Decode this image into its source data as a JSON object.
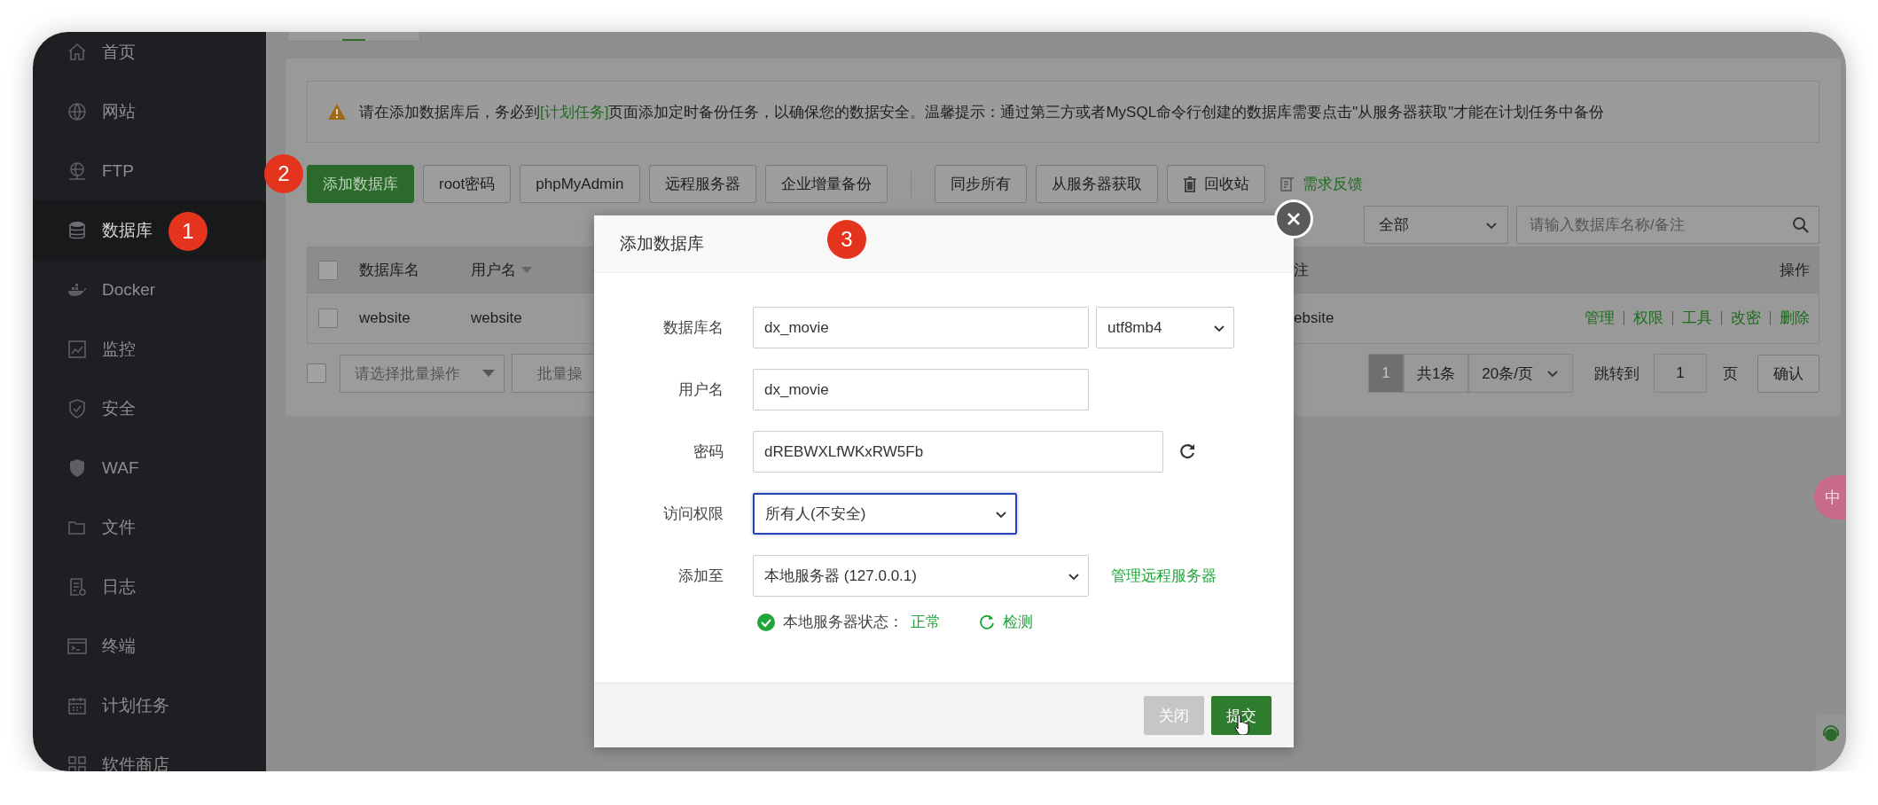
{
  "sidebar": {
    "items": [
      {
        "label": "首页",
        "selected": false
      },
      {
        "label": "网站",
        "selected": false
      },
      {
        "label": "FTP",
        "selected": false
      },
      {
        "label": "数据库",
        "selected": true
      },
      {
        "label": "Docker",
        "selected": false
      },
      {
        "label": "监控",
        "selected": false
      },
      {
        "label": "安全",
        "selected": false
      },
      {
        "label": "WAF",
        "selected": false
      },
      {
        "label": "文件",
        "selected": false
      },
      {
        "label": "日志",
        "selected": false
      },
      {
        "label": "终端",
        "selected": false
      },
      {
        "label": "计划任务",
        "selected": false
      },
      {
        "label": "软件商店",
        "selected": false
      }
    ]
  },
  "notice": {
    "text_before": "请在添加数据库后，务必到",
    "link": "[计划任务]",
    "text_after": "页面添加定时备份任务，以确保您的数据安全。温馨提示：通过第三方或者MySQL命令行创建的数据库需要点击\"从服务器获取\"才能在计划任务中备份"
  },
  "toolbar": {
    "buttons": [
      {
        "label": "添加数据库",
        "kind": "primary"
      },
      {
        "label": "root密码",
        "kind": "plain"
      },
      {
        "label": "phpMyAdmin",
        "kind": "plain"
      },
      {
        "label": "远程服务器",
        "kind": "plain"
      },
      {
        "label": "企业增量备份",
        "kind": "plain"
      },
      {
        "label": "同步所有",
        "kind": "plain"
      },
      {
        "label": "从服务器获取",
        "kind": "plain"
      },
      {
        "label": "回收站",
        "kind": "trash"
      },
      {
        "label": "需求反馈",
        "kind": "link"
      }
    ]
  },
  "filter": {
    "select": "全部",
    "search_placeholder": "请输入数据库名称/备注"
  },
  "table": {
    "select_all_checked": false,
    "columns": [
      "数据库名",
      "用户名",
      "注",
      "操作"
    ],
    "rows": [
      {
        "checked": false,
        "cells": [
          "website",
          "website",
          "ebsite"
        ],
        "actions": [
          "管理",
          "权限",
          "工具",
          "改密",
          "删除"
        ]
      }
    ]
  },
  "footer": {
    "checked": false,
    "batch_select": "请选择批量操作",
    "batch_button": "批量操",
    "page": "1",
    "total": "共1条",
    "per_page": "20条/页",
    "jump_label": "跳转到",
    "jump_value": "1",
    "page_unit": "页",
    "confirm": "确认"
  },
  "modal": {
    "title": "添加数据库",
    "fields": [
      {
        "label": "数据库名",
        "kind": "input_select",
        "value": "dx_movie",
        "select": "utf8mb4"
      },
      {
        "label": "用户名",
        "kind": "input",
        "value": "dx_movie"
      },
      {
        "label": "密码",
        "kind": "password",
        "value": "dREBWXLfWKxRW5Fb"
      },
      {
        "label": "访问权限",
        "kind": "select",
        "value": "所有人(不安全)",
        "focused": true
      },
      {
        "label": "添加至",
        "kind": "select_link",
        "value": "本地服务器 (127.0.0.1)",
        "link": "管理远程服务器"
      }
    ],
    "status": {
      "label": "本地服务器状态：",
      "value": "正常",
      "action": "检测"
    },
    "buttons": [
      {
        "label": "关闭",
        "kind": "secondary"
      },
      {
        "label": "提交",
        "kind": "primary"
      }
    ]
  },
  "floating": {
    "translate": "中"
  },
  "annotations": [
    {
      "label": "1"
    },
    {
      "label": "2"
    },
    {
      "label": "3"
    }
  ]
}
